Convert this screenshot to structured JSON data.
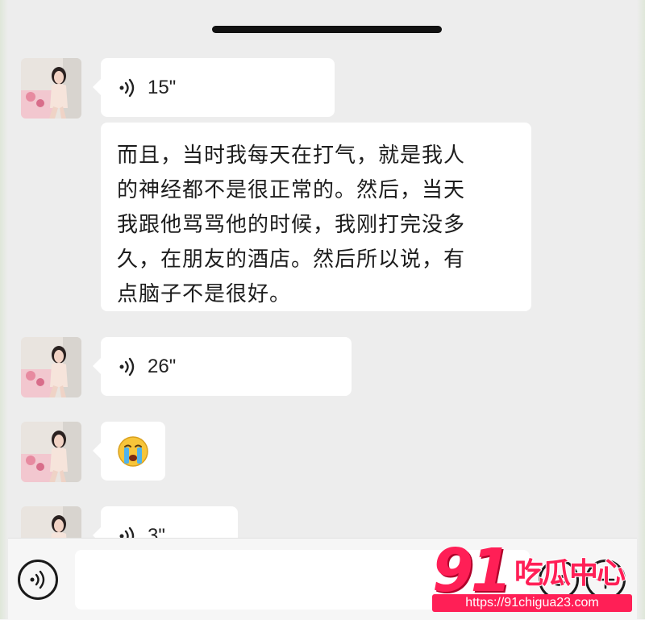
{
  "messages": [
    {
      "type": "voice",
      "duration": "15\""
    },
    {
      "type": "text",
      "lines": [
        "而且，当时我每天在打气，就是我人",
        "的神经都不是很正常的。然后，当天",
        "我跟他骂骂他的时候，我刚打完没多",
        "久，在朋友的酒店。然后所以说，有",
        "点脑子不是很好。"
      ]
    },
    {
      "type": "voice",
      "duration": "26\""
    },
    {
      "type": "emoji",
      "emoji": "😭"
    },
    {
      "type": "voice",
      "duration": "3\""
    }
  ],
  "watermark": {
    "logo_number": "91",
    "logo_text": "吃瓜中心",
    "url": "https://91chigua23.com"
  },
  "icons": {
    "voice_play": "voice-wave-icon",
    "voice_toggle": "voice-mode-icon",
    "emoji": "smiley-icon",
    "plus": "plus-icon"
  },
  "colors": {
    "background": "#ededed",
    "bubble": "#ffffff",
    "watermark": "#ff1f56"
  }
}
